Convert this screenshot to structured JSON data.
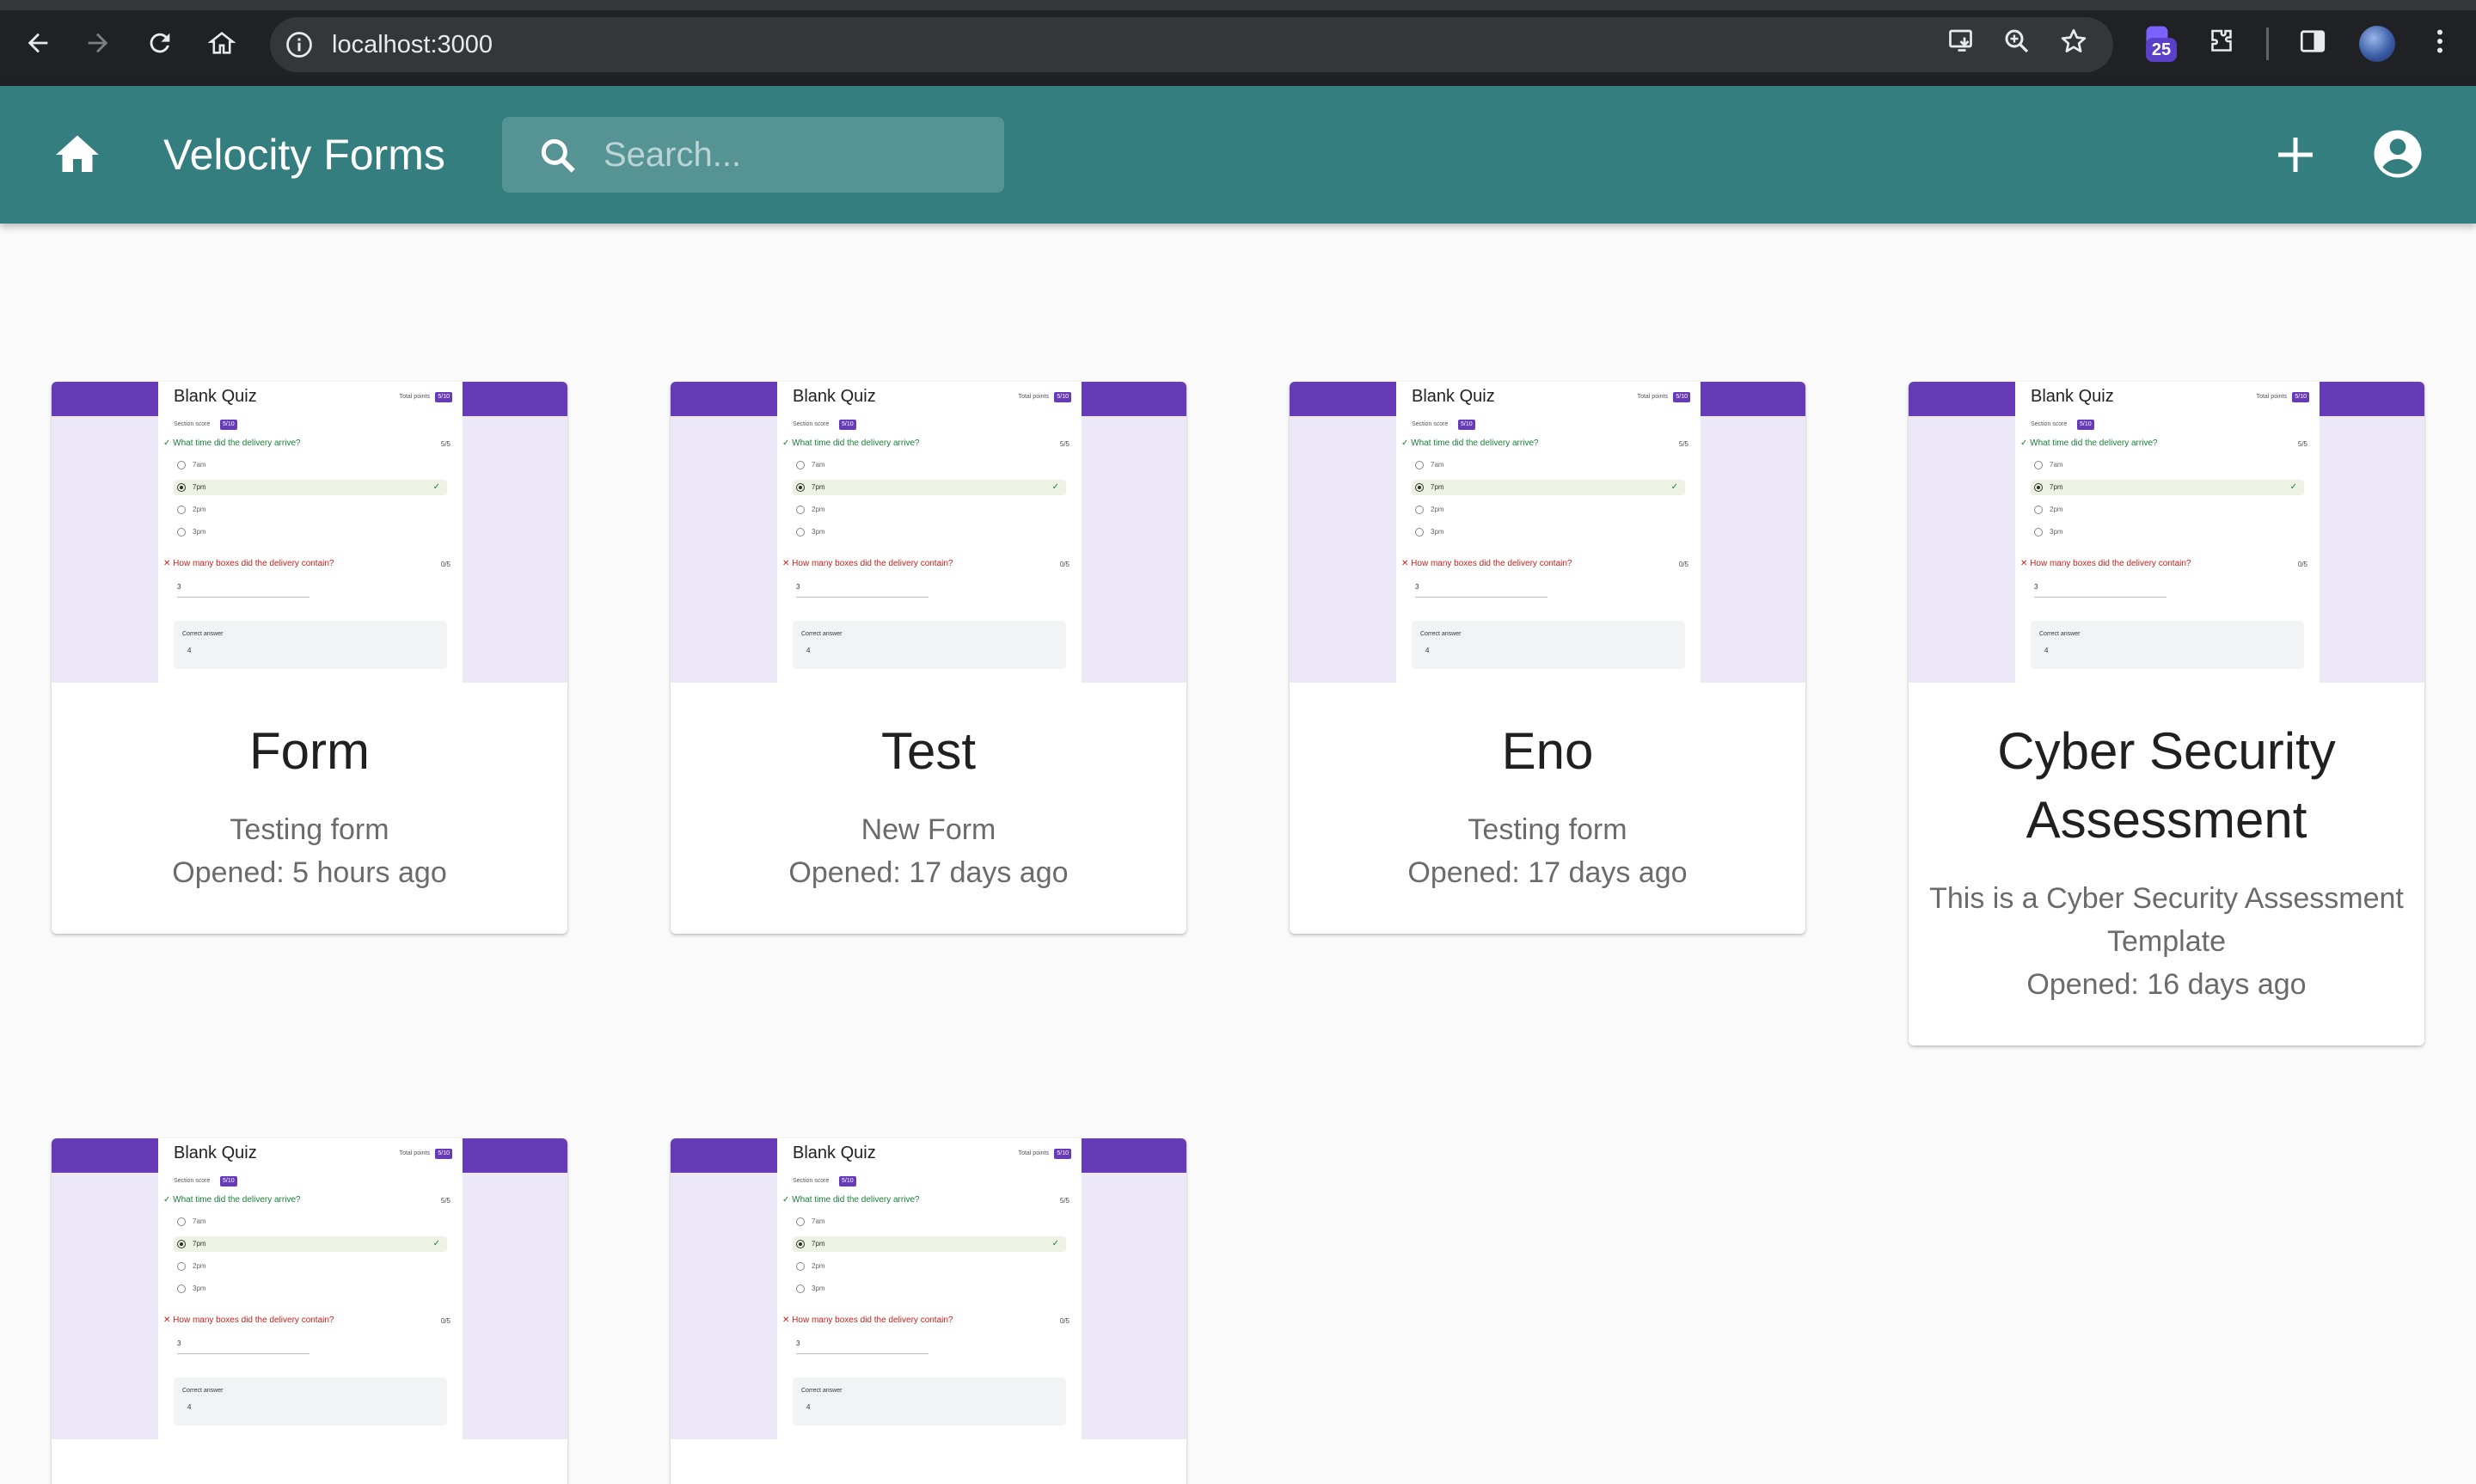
{
  "browser": {
    "url": "localhost:3000",
    "extension_badge": "25"
  },
  "app": {
    "title": "Velocity Forms",
    "search_placeholder": "Search..."
  },
  "thumbnail": {
    "quiz_title": "Blank Quiz",
    "total_points_label": "Total points",
    "total_points_value": "5/10",
    "section_score_label": "Section score",
    "section_score_value": "5/10",
    "q1": "What time did the delivery arrive?",
    "q1_points": "5/5",
    "options": [
      "7am",
      "7pm",
      "2pm",
      "3pm"
    ],
    "q2": "How many boxes did the delivery contain?",
    "q2_points": "0/5",
    "q2_answer": "3",
    "correct_answer_label": "Correct answer",
    "correct_answer_value": "4"
  },
  "forms": [
    {
      "title": "Form",
      "description": "Testing form",
      "opened": "Opened: 5 hours ago"
    },
    {
      "title": "Test",
      "description": "New Form",
      "opened": "Opened: 17 days ago"
    },
    {
      "title": "Eno",
      "description": "Testing form",
      "opened": "Opened: 17 days ago"
    },
    {
      "title": "Cyber Security Assessment",
      "description": "This is a Cyber Security Assessment Template",
      "opened": "Opened: 16 days ago"
    },
    {
      "title": "",
      "description": "",
      "opened": ""
    },
    {
      "title": "",
      "description": "",
      "opened": ""
    }
  ],
  "colors": {
    "appbar": "#347e7f",
    "quiz_accent": "#673ab7",
    "page_background": "#fafafa"
  }
}
